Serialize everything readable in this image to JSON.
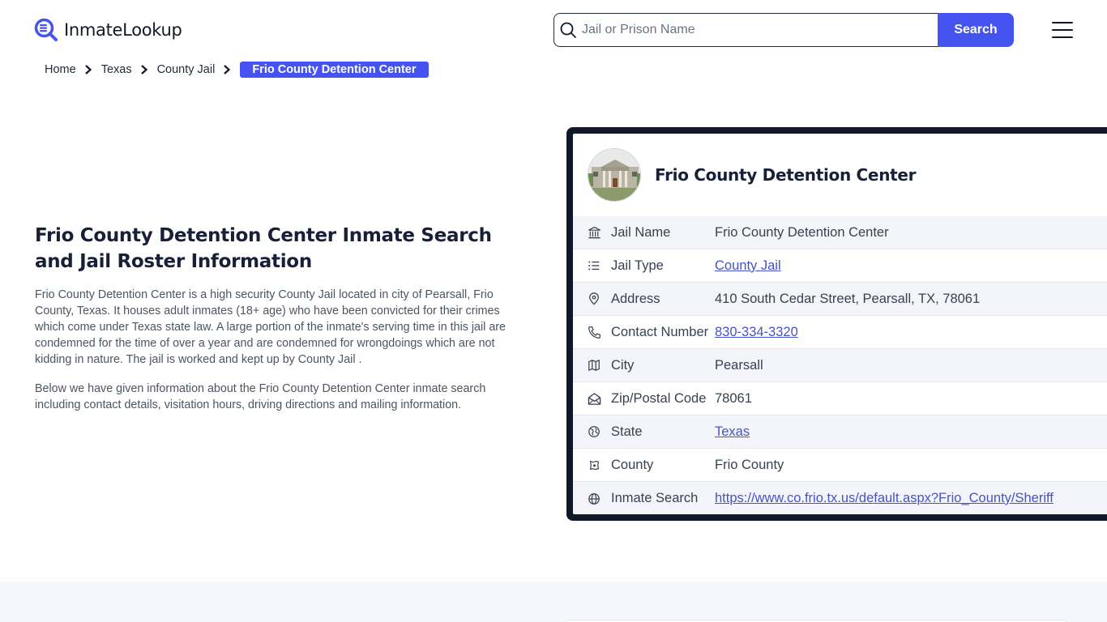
{
  "header": {
    "logo_text": "InmateLookup",
    "search_placeholder": "Jail or Prison Name",
    "search_button": "Search"
  },
  "breadcrumb": {
    "items": [
      "Home",
      "Texas",
      "County Jail"
    ],
    "active": "Frio County Detention Center"
  },
  "main": {
    "title": "Frio County Detention Center Inmate Search and Jail Roster Information",
    "paragraphs": [
      "Frio County Detention Center is a high security County Jail located in city of Pearsall, Frio County, Texas. It houses adult inmates (18+ age) who have been convicted for their crimes which come under Texas state law. A large portion of the inmate's serving time in this jail are condemned for the time of over a year and are condemned for wrongdoings which are not kidding in nature. The jail is worked and kept up by County Jail .",
      "Below we have given information about the Frio County Detention Center inmate search including contact details, visitation hours, driving directions and mailing information."
    ]
  },
  "card": {
    "title": "Frio County Detention Center",
    "rows": [
      {
        "icon": "building-columns-icon",
        "label": "Jail Name",
        "value": "Frio County Detention Center",
        "link": false
      },
      {
        "icon": "list-icon",
        "label": "Jail Type",
        "value": "County Jail",
        "link": true
      },
      {
        "icon": "map-pin-icon",
        "label": "Address",
        "value": "410 South Cedar Street, Pearsall, TX, 78061",
        "link": false
      },
      {
        "icon": "phone-icon",
        "label": "Contact Number",
        "value": "830-334-3320",
        "link": true
      },
      {
        "icon": "map-icon",
        "label": "City",
        "value": "Pearsall",
        "link": false
      },
      {
        "icon": "mail-open-icon",
        "label": "Zip/Postal Code",
        "value": "78061",
        "link": false
      },
      {
        "icon": "globe-americas-icon",
        "label": "State",
        "value": "Texas",
        "link": true
      },
      {
        "icon": "county-map-icon",
        "label": "County",
        "value": "Frio County",
        "link": false
      },
      {
        "icon": "globe-icon",
        "label": "Inmate Search",
        "value": "https://www.co.frio.tx.us/default.aspx?Frio_County/Sheriff",
        "link": true
      }
    ]
  },
  "colors": {
    "accent": "#4553f0",
    "card_border": "#111827",
    "link": "#4553c9",
    "heading": "#172036"
  }
}
